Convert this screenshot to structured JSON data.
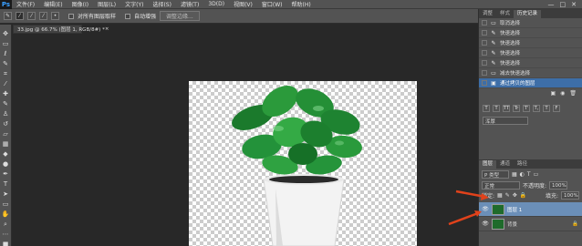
{
  "app": {
    "logo": "Ps",
    "window_controls": [
      "—",
      "□",
      "✕"
    ]
  },
  "menu": [
    "文件(F)",
    "编辑(E)",
    "图像(I)",
    "图层(L)",
    "文字(Y)",
    "选择(S)",
    "滤镜(T)",
    "3D(D)",
    "视图(V)",
    "窗口(W)",
    "帮助(H)"
  ],
  "options": {
    "sample_all_layers": "对所有图层取样",
    "auto_enhance": "自动增强",
    "refine_edge": "调整边缘..."
  },
  "document_tab": {
    "title": "33.jpg @ 66.7% (图层 1, RGB/8#) *",
    "close": "×"
  },
  "history": {
    "tabs": [
      "调整",
      "样式",
      "历史记录"
    ],
    "items": [
      "取消选择",
      "快速选择",
      "快速选择",
      "快速选择",
      "快速选择",
      "减去快速选择",
      "通过拷贝的图层"
    ]
  },
  "character": {
    "font_select": "浑厚",
    "type_buttons": [
      "T",
      "T",
      "TT",
      "Tr",
      "T'",
      "T,",
      "T",
      "F"
    ]
  },
  "layers": {
    "tabs": [
      "图层",
      "通道",
      "路径"
    ],
    "filter": "P 类型",
    "blend_mode": "正常",
    "opacity_label": "不透明度:",
    "opacity_value": "100%",
    "lock_label": "锁定:",
    "fill_label": "填充:",
    "fill_value": "100%",
    "items": [
      {
        "name": "图层 1",
        "selected": true
      },
      {
        "name": "背景",
        "selected": false
      }
    ]
  },
  "colors": {
    "accent": "#3d6ea8",
    "panel": "#535353",
    "canvas_bg": "#282828",
    "arrow": "#e0421b"
  }
}
